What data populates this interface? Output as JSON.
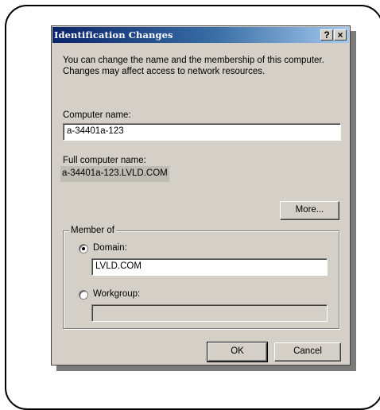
{
  "window": {
    "title": "Identification Changes",
    "help_label": "?",
    "close_label": "×"
  },
  "description": "You can change the name and the membership of this computer. Changes may affect access to network resources.",
  "computer_name": {
    "label": "Computer name:",
    "value": "a-34401a-123"
  },
  "full_computer_name": {
    "label": "Full computer name:",
    "value": "a-34401a-123.LVLD.COM"
  },
  "more_button": "More...",
  "member_of": {
    "label": "Member of",
    "domain": {
      "label": "Domain:",
      "value": "LVLD.COM",
      "selected": true
    },
    "workgroup": {
      "label": "Workgroup:",
      "value": "",
      "selected": false
    }
  },
  "buttons": {
    "ok": "OK",
    "cancel": "Cancel"
  },
  "colors": {
    "titlebar_start": "#0a246a",
    "titlebar_end": "#a6caf0",
    "dialog_bg": "#d4d0c8"
  }
}
